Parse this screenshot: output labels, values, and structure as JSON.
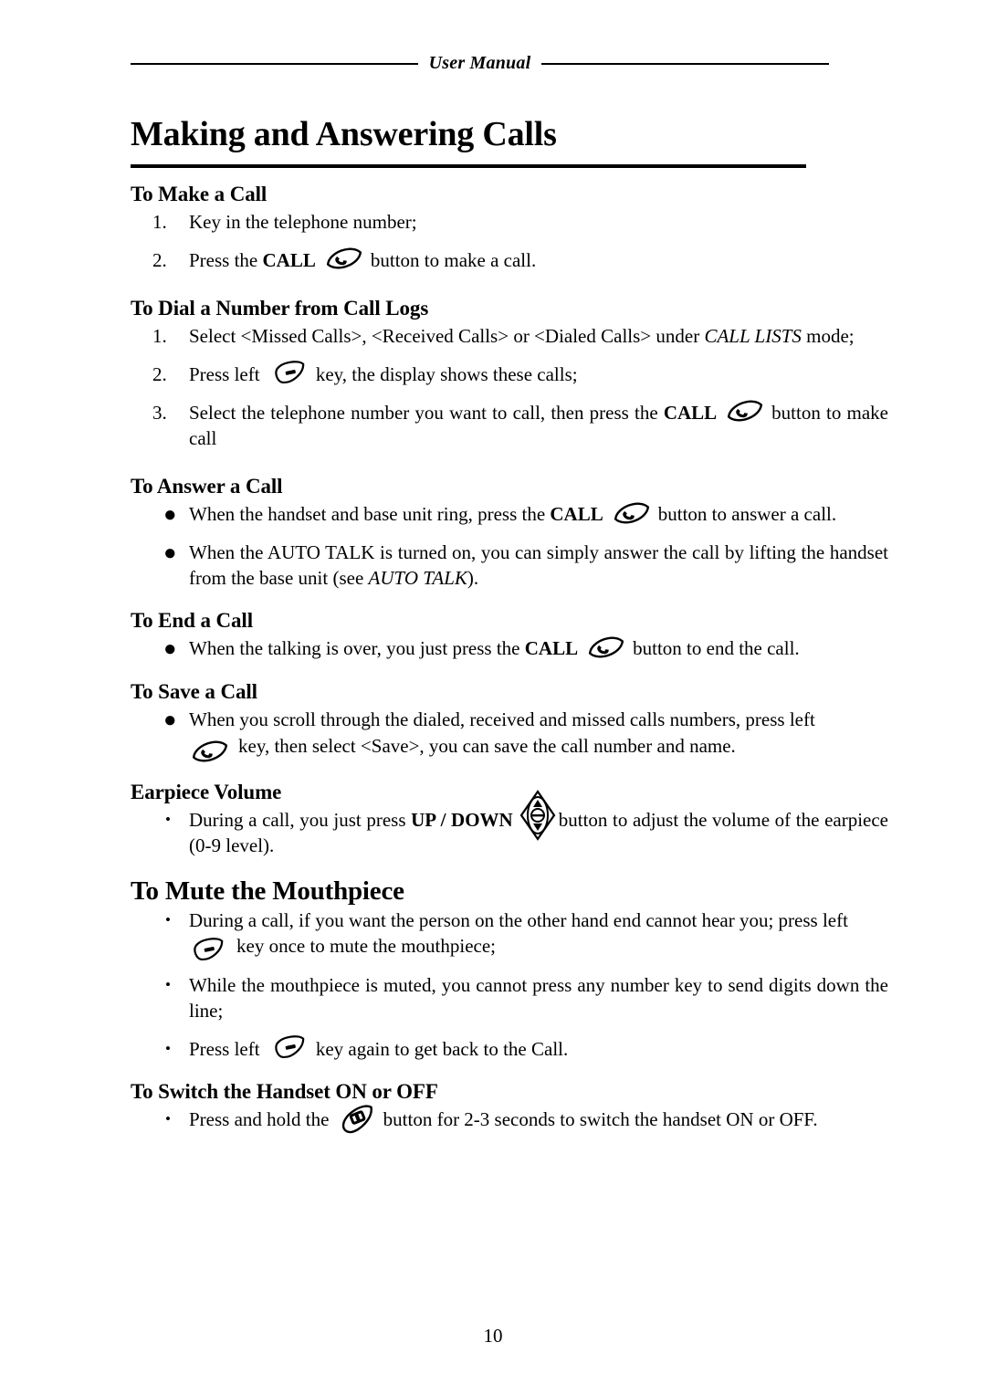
{
  "header": {
    "running_title": "User Manual"
  },
  "page_title": "Making and Answering Calls",
  "footer": {
    "page_number": "10"
  },
  "icons": {
    "call": "call-key-icon",
    "soft_left": "left-soft-key-icon",
    "volume": "up-down-rocker-icon",
    "power": "power-key-icon"
  },
  "sections": [
    {
      "id": "to-make-a-call",
      "heading": "To Make a Call",
      "list_type": "ordered",
      "items": [
        {
          "marker": "1.",
          "text_before": "Key in the telephone number;",
          "icon": null,
          "text_after": ""
        },
        {
          "marker": "2.",
          "text_before": "Press the ",
          "bold": "CALL",
          "icon": "call",
          "text_after": "button to make a call."
        }
      ]
    },
    {
      "id": "to-dial-a-number-from-call-logs",
      "heading": "To Dial a Number from Call Logs",
      "list_type": "ordered",
      "items": [
        {
          "marker": "1.",
          "text_before": "Select <Missed Calls>, <Received Calls> or <Dialed Calls> under ",
          "italic": "CALL LISTS",
          "text_after": " mode;"
        },
        {
          "marker": "2.",
          "text_before": "Press left ",
          "icon": "soft_left",
          "text_after": "key, the display shows these calls;"
        },
        {
          "marker": "3.",
          "text_before": "Select the telephone number you want to call, then press the ",
          "bold": "CALL",
          "icon": "call",
          "text_after": "button to make call"
        }
      ]
    },
    {
      "id": "to-answer-a-call",
      "heading": "To Answer a Call",
      "list_type": "bullet-large",
      "items": [
        {
          "marker": "●",
          "text_before": "When the handset and base unit ring, press the ",
          "bold": "CALL",
          "icon": "call",
          "text_after": "button to answer a call."
        },
        {
          "marker": "●",
          "text_before": "When the AUTO TALK is turned on, you can simply answer the call by lifting the handset from the base unit (see ",
          "italic": "AUTO TALK",
          "text_after": ")."
        }
      ]
    },
    {
      "id": "to-end-a-call",
      "heading": "To End a Call",
      "list_type": "bullet-large",
      "items": [
        {
          "marker": "●",
          "text_before": "When the talking is over, you just press the ",
          "bold": "CALL",
          "icon": "call",
          "text_after": "button to end the call."
        }
      ]
    },
    {
      "id": "to-save-a-call",
      "heading": "To Save a Call",
      "list_type": "bullet-large",
      "items": [
        {
          "marker": "●",
          "text_before": "When you scroll through the dialed, received and missed calls numbers, press left ",
          "icon_lead": "call",
          "text_after": "key, then select <Save>, you can save the call number and name."
        }
      ]
    },
    {
      "id": "earpiece-volume",
      "heading": "Earpiece Volume",
      "list_type": "bullet-small",
      "items": [
        {
          "marker": "•",
          "text_before": "During a call, you just press ",
          "bold": "UP / DOWN",
          "icon": "volume",
          "text_after": "button to adjust the volume of the earpiece (0-9 level)."
        }
      ]
    },
    {
      "id": "to-mute-the-mouthpiece",
      "heading": "To Mute the Mouthpiece",
      "heading_level": "big",
      "list_type": "bullet-small",
      "items": [
        {
          "marker": "•",
          "text_before": "During a call, if you want the person on the other hand end cannot hear you; press left ",
          "icon_lead": "soft_left",
          "text_after": "key once to mute the mouthpiece;"
        },
        {
          "marker": "•",
          "text_before": "While the mouthpiece is muted, you cannot press any number key to send digits down the line;",
          "text_after": ""
        },
        {
          "marker": "•",
          "text_before": "Press left ",
          "icon": "soft_left",
          "text_after": "key again to get back to the Call."
        }
      ]
    },
    {
      "id": "to-switch-the-handset-on-or-off",
      "heading": "To Switch the Handset ON or OFF",
      "list_type": "bullet-small",
      "items": [
        {
          "marker": "•",
          "text_before": "Press and hold the ",
          "icon": "power",
          "text_after": "button for 2-3 seconds to switch the handset ON or OFF."
        }
      ]
    }
  ]
}
